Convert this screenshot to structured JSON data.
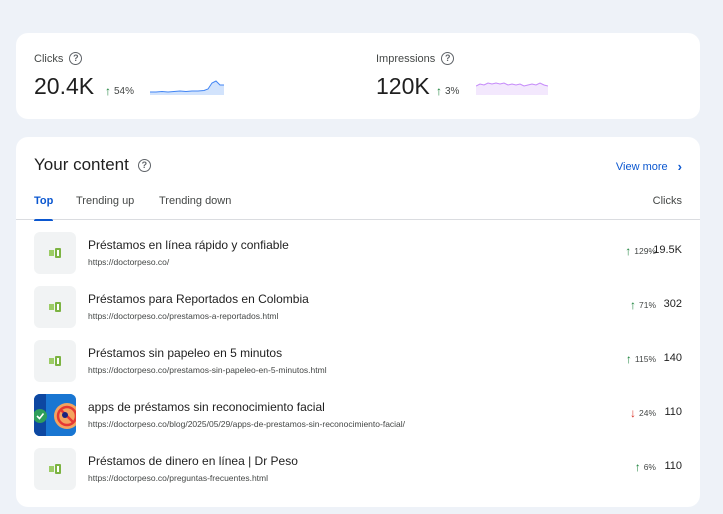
{
  "metrics": {
    "clicks": {
      "label": "Clicks",
      "value": "20.4K",
      "change": "54%",
      "trend": "up"
    },
    "impressions": {
      "label": "Impressions",
      "value": "120K",
      "change": "3%",
      "trend": "up"
    }
  },
  "content": {
    "title": "Your content",
    "view_more": "View more",
    "tabs": [
      "Top",
      "Trending up",
      "Trending down"
    ],
    "column_header": "Clicks",
    "rows": [
      {
        "title": "Préstamos en línea rápido y confiable",
        "url": "https://doctorpeso.co/",
        "change": "129%",
        "trend": "up",
        "clicks": "19.5K"
      },
      {
        "title": "Préstamos para Reportados en Colombia",
        "url": "https://doctorpeso.co/prestamos-a-reportados.html",
        "change": "71%",
        "trend": "up",
        "clicks": "302"
      },
      {
        "title": "Préstamos sin papeleo en 5 minutos",
        "url": "https://doctorpeso.co/prestamos-sin-papeleo-en-5-minutos.html",
        "change": "115%",
        "trend": "up",
        "clicks": "140"
      },
      {
        "title": "apps de préstamos sin reconocimiento facial",
        "url": "https://doctorpeso.co/blog/2025/05/29/apps-de-prestamos-sin-reconocimiento-facial/",
        "change": "24%",
        "trend": "down",
        "clicks": "110"
      },
      {
        "title": "Préstamos de dinero en línea | Dr Peso",
        "url": "https://doctorpeso.co/preguntas-frecuentes.html",
        "change": "6%",
        "trend": "up",
        "clicks": "110"
      }
    ]
  },
  "colors": {
    "accent": "#0b57d0",
    "up": "#188038",
    "down": "#d93025",
    "clicks_spark": "#4285f4",
    "impressions_spark": "#a142f4"
  }
}
